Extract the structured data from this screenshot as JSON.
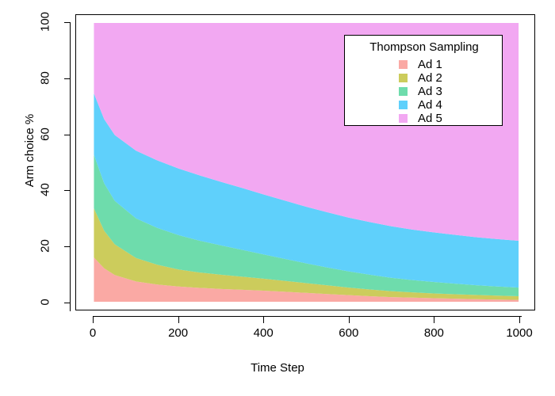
{
  "chart_data": {
    "type": "area",
    "stacked": true,
    "title": "",
    "xlabel": "Time Step",
    "ylabel": "Arm choice %",
    "xlim": [
      0,
      1000
    ],
    "ylim": [
      0,
      100
    ],
    "grid": false,
    "x_ticks": [
      "0",
      "200",
      "400",
      "600",
      "800",
      "1000"
    ],
    "y_ticks": [
      "0",
      "20",
      "40",
      "60",
      "80",
      "100"
    ],
    "legend": {
      "title": "Thompson Sampling",
      "position": "top-right",
      "entries": [
        "Ad 1",
        "Ad 2",
        "Ad 3",
        "Ad 4",
        "Ad 5"
      ]
    },
    "colors": {
      "ad1": "#faa9a4",
      "ad2": "#cccc5c",
      "ad3": "#6edcac",
      "ad4": "#5fd0fb",
      "ad5": "#f2a8f2",
      "axis": "#000000",
      "background": "#ffffff"
    },
    "x": [
      1,
      25,
      50,
      100,
      150,
      200,
      250,
      300,
      350,
      400,
      450,
      500,
      550,
      600,
      650,
      700,
      750,
      800,
      850,
      900,
      950,
      1000
    ],
    "series": [
      {
        "name": "Ad 1",
        "color": "#faa9a4",
        "values": [
          15.9,
          12.0,
          9.6,
          7.3,
          6.2,
          5.5,
          5.0,
          4.6,
          4.3,
          4.0,
          3.6,
          3.2,
          2.8,
          2.4,
          2.0,
          1.7,
          1.5,
          1.3,
          1.1,
          0.95,
          0.8,
          0.7
        ]
      },
      {
        "name": "Ad 2",
        "color": "#cccc5c",
        "values": [
          17.6,
          13.5,
          11.0,
          8.4,
          7.1,
          6.1,
          5.5,
          5.1,
          4.7,
          4.3,
          3.9,
          3.5,
          3.1,
          2.7,
          2.4,
          2.1,
          1.9,
          1.7,
          1.6,
          1.5,
          1.4,
          1.3
        ]
      },
      {
        "name": "Ad 3",
        "color": "#6edcac",
        "values": [
          19.2,
          17.0,
          15.6,
          14.2,
          13.2,
          12.3,
          11.4,
          10.5,
          9.6,
          8.7,
          7.9,
          7.1,
          6.4,
          5.8,
          5.3,
          4.8,
          4.4,
          4.1,
          3.8,
          3.5,
          3.3,
          3.1
        ]
      },
      {
        "name": "Ad 4",
        "color": "#5fd0fb",
        "values": [
          22.0,
          23.0,
          23.6,
          24.3,
          24.2,
          23.9,
          23.4,
          22.8,
          22.2,
          21.5,
          20.9,
          20.3,
          19.8,
          19.3,
          18.9,
          18.5,
          18.1,
          17.8,
          17.5,
          17.2,
          17.0,
          16.8
        ]
      },
      {
        "name": "Ad 5",
        "color": "#f2a8f2",
        "values": [
          25.3,
          34.5,
          40.2,
          45.8,
          49.3,
          52.2,
          54.7,
          57.0,
          59.2,
          61.5,
          63.7,
          65.9,
          67.9,
          69.8,
          71.4,
          72.9,
          74.1,
          75.1,
          76.0,
          76.85,
          77.5,
          78.1
        ]
      }
    ]
  }
}
